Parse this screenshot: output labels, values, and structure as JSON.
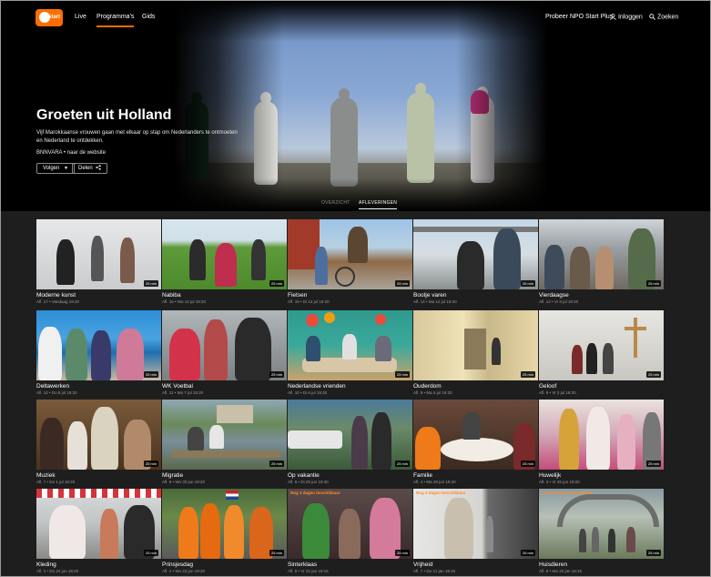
{
  "nav": {
    "logo_text": "start",
    "links": [
      "Live",
      "Programma's",
      "Gids"
    ],
    "plus_label": "Probeer NPO Start Plus",
    "login_label": "Inloggen",
    "search_label": "Zoeken",
    "accent": "#ff6d00"
  },
  "show": {
    "title": "Groeten uit Holland",
    "description": "Vijf Marokkaanse vrouwen gaan met elkaar op stap om Nederlanders te ontmoeten en Nederland te ontdekken.",
    "broadcaster": "BNNVARA • naar de website",
    "follow_label": "Volgen",
    "share_label": "Delen"
  },
  "tabs": {
    "overview": "OVERZICHT",
    "episodes": "AFLEVERINGEN"
  },
  "episodes": [
    {
      "title": "Moderne kunst",
      "meta": "Afl. 17 • Vandaag 19:20",
      "duration": "25 min",
      "availability": ""
    },
    {
      "title": "Nabiba",
      "meta": "Afl. 16 • Wo 14 jul 19:20",
      "duration": "25 min",
      "availability": ""
    },
    {
      "title": "Fietsen",
      "meta": "Afl. 15 • Di 13 jul 19:20",
      "duration": "25 min",
      "availability": ""
    },
    {
      "title": "Bootje varen",
      "meta": "Afl. 14 • Ma 12 jul 19:20",
      "duration": "25 min",
      "availability": ""
    },
    {
      "title": "Vierdaagse",
      "meta": "Afl. 13 • Vr 9 jul 19:20",
      "duration": "25 min",
      "availability": ""
    },
    {
      "title": "Deltawerken",
      "meta": "Afl. 12 • Do 8 jul 19:20",
      "duration": "25 min",
      "availability": ""
    },
    {
      "title": "WK Voetbal",
      "meta": "Afl. 11 • Wo 7 jul 19:20",
      "duration": "25 min",
      "availability": ""
    },
    {
      "title": "Nederlandse vrienden",
      "meta": "Afl. 10 • Di 6 jul 19:20",
      "duration": "25 min",
      "availability": ""
    },
    {
      "title": "Ouderdom",
      "meta": "Afl. 9 • Ma 5 jul 19:20",
      "duration": "25 min",
      "availability": ""
    },
    {
      "title": "Geloof",
      "meta": "Afl. 8 • Vr 2 jul 19:20",
      "duration": "25 min",
      "availability": ""
    },
    {
      "title": "Muziek",
      "meta": "Afl. 7 • Do 1 jul 19:20",
      "duration": "25 min",
      "availability": ""
    },
    {
      "title": "Migratie",
      "meta": "Afl. 6 • Wo 30 jun 19:20",
      "duration": "25 min",
      "availability": ""
    },
    {
      "title": "Op vakantie",
      "meta": "Afl. 5 • Di 29 jun 19:20",
      "duration": "25 min",
      "availability": ""
    },
    {
      "title": "Familie",
      "meta": "Afl. 4 • Ma 28 jun 19:20",
      "duration": "25 min",
      "availability": ""
    },
    {
      "title": "Huwelijk",
      "meta": "Afl. 3 • Vr 25 jun 19:20",
      "duration": "25 min",
      "availability": ""
    },
    {
      "title": "Kleding",
      "meta": "Afl. 2 • Do 24 jun 19:20",
      "duration": "25 min",
      "availability": ""
    },
    {
      "title": "Prinsjesdag",
      "meta": "Afl. 1 • Wo 23 jun 19:20",
      "duration": "25 min",
      "availability": ""
    },
    {
      "title": "Sinterklaas",
      "meta": "Afl. 8 • Vr 22 jan 19:15",
      "duration": "25 min",
      "availability": "Nog 3 dagen beschikbaar"
    },
    {
      "title": "Vrijheid",
      "meta": "Afl. 7 • Do 21 jan 19:15",
      "duration": "25 min",
      "availability": "Nog 3 dagen beschikbaar"
    },
    {
      "title": "Huisdieren",
      "meta": "Afl. 6 • Wo 20 jan 19:15",
      "duration": "25 min",
      "availability": "Nog 28 dagen beschikbaar"
    }
  ]
}
